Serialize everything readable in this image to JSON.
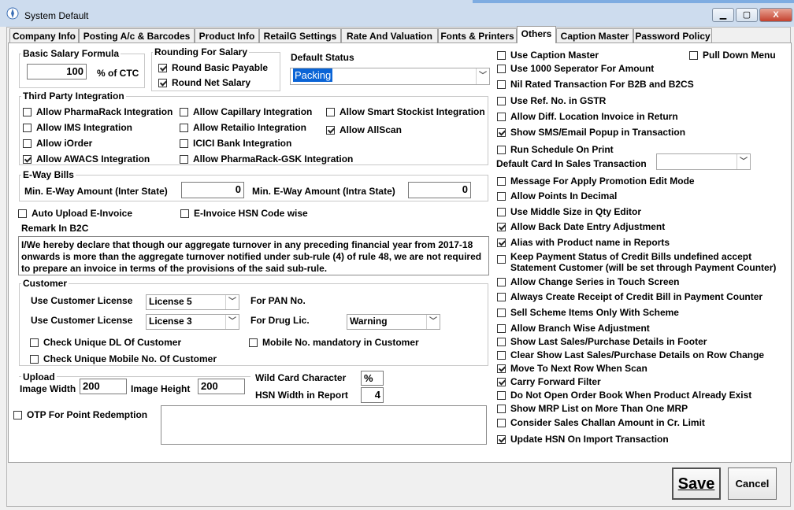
{
  "window": {
    "title": "System Default",
    "min": "▁",
    "max": "▢",
    "close": "X"
  },
  "tabs": [
    "Company Info",
    "Posting A/c & Barcodes",
    "Product Info",
    "RetailG Settings",
    "Rate And Valuation",
    "Fonts & Printers",
    "Others",
    "Caption Master",
    "Password Policy"
  ],
  "salary": {
    "formula_title": "Basic Salary Formula",
    "value": "100",
    "unit": "% of CTC",
    "rounding_title": "Rounding For Salary",
    "round_basic": "Round Basic Payable",
    "round_net": "Round Net Salary"
  },
  "default_status": {
    "label": "Default Status",
    "value": "Packing"
  },
  "third_party": {
    "title": "Third Party Integration",
    "items": [
      {
        "label": "Allow PharmaRack Integration",
        "checked": false
      },
      {
        "label": "Allow IMS Integration",
        "checked": false
      },
      {
        "label": "Allow iOrder",
        "checked": false
      },
      {
        "label": "Allow AWACS Integration",
        "checked": true
      },
      {
        "label": "Allow Capillary Integration",
        "checked": false
      },
      {
        "label": "Allow Retailio Integration",
        "checked": false
      },
      {
        "label": "ICICI Bank Integration",
        "checked": false
      },
      {
        "label": "Allow PharmaRack-GSK Integration",
        "checked": false
      },
      {
        "label": "Allow Smart Stockist Integration",
        "checked": false
      },
      {
        "label": "Allow AllScan",
        "checked": true
      }
    ]
  },
  "eway": {
    "title": "E-Way Bills",
    "inter_label": "Min. E-Way Amount (Inter State)",
    "inter_value": "0",
    "intra_label": "Min. E-Way Amount (Intra State)",
    "intra_value": "0"
  },
  "einvoice": {
    "auto_upload": "Auto Upload E-Invoice",
    "hsn_wise": "E-Invoice HSN Code wise"
  },
  "remark": {
    "label": "Remark In B2C",
    "text": "I/We hereby declare that though our aggregate turnover in any preceding financial year from 2017-18 onwards is more than the aggregate turnover notified under sub-rule (4) of rule 48, we are not required to prepare an invoice in terms of the provisions of the said sub-rule."
  },
  "customer": {
    "title": "Customer",
    "license_label": "Use Customer License",
    "pan_license": "License 5",
    "pan_label": "For PAN No.",
    "drug_license": "License 3",
    "drug_label": "For Drug Lic.",
    "drug_mode": "Warning",
    "check_dl": "Check Unique DL Of Customer",
    "mobile_mandatory": "Mobile No. mandatory in Customer",
    "check_mobile": "Check Unique Mobile No. Of Customer"
  },
  "upload": {
    "title": "Upload",
    "width_label": "Image Width",
    "width_value": "200",
    "height_label": "Image Height",
    "height_value": "200"
  },
  "wildcard": {
    "label": "Wild Card Character",
    "value": "%"
  },
  "hsn_width": {
    "label": "HSN Width in Report",
    "value": "4"
  },
  "otp": {
    "label": "OTP For Point Redemption"
  },
  "right_options": [
    {
      "label": "Use Caption Master",
      "checked": false
    },
    {
      "label": "Use 1000 Seperator For Amount",
      "checked": false
    },
    {
      "label": "Nil Rated Transaction For B2B and B2CS",
      "checked": false
    },
    {
      "label": "Use Ref. No. in GSTR",
      "checked": false
    },
    {
      "label": "Allow Diff. Location Invoice in Return",
      "checked": false
    },
    {
      "label": "Show SMS/Email Popup in Transaction",
      "checked": true
    },
    {
      "label": "Run Schedule On Print",
      "checked": false
    },
    {
      "label": "Message For Apply Promotion Edit Mode",
      "checked": false
    },
    {
      "label": "Allow Points In Decimal",
      "checked": false
    },
    {
      "label": "Use Middle Size in Qty Editor",
      "checked": false
    },
    {
      "label": "Allow Back Date Entry Adjustment",
      "checked": true
    },
    {
      "label": "Alias with Product name in Reports",
      "checked": true
    },
    {
      "label": "Keep Payment Status of Credit Bills undefined accept",
      "label2": "Statement Customer (will be set through Payment Counter)",
      "checked": false
    },
    {
      "label": "Allow Change Series in Touch Screen",
      "checked": false
    },
    {
      "label": "Always Create Receipt of Credit Bill in Payment Counter",
      "checked": false
    },
    {
      "label": "Sell Scheme Items Only With Scheme",
      "checked": false
    },
    {
      "label": "Allow Branch Wise Adjustment",
      "checked": false
    },
    {
      "label": "Show Last Sales/Purchase Details in Footer",
      "checked": false
    },
    {
      "label": "Clear Show Last Sales/Purchase Details on Row Change",
      "checked": false
    },
    {
      "label": "Move To Next Row When Scan",
      "checked": true
    },
    {
      "label": "Carry Forward Filter",
      "checked": true
    },
    {
      "label": "Do Not Open Order Book When Product Already Exist",
      "checked": false
    },
    {
      "label": "Show MRP List on More Than One MRP",
      "checked": false
    },
    {
      "label": "Consider Sales Challan Amount in Cr. Limit",
      "checked": false
    },
    {
      "label": "Update HSN On Import Transaction",
      "checked": true
    }
  ],
  "pull_down_menu": {
    "label": "Pull Down Menu",
    "checked": false
  },
  "default_card": {
    "label": "Default Card In Sales Transaction",
    "value": ""
  },
  "buttons": {
    "save": "Save",
    "cancel": "Cancel"
  }
}
